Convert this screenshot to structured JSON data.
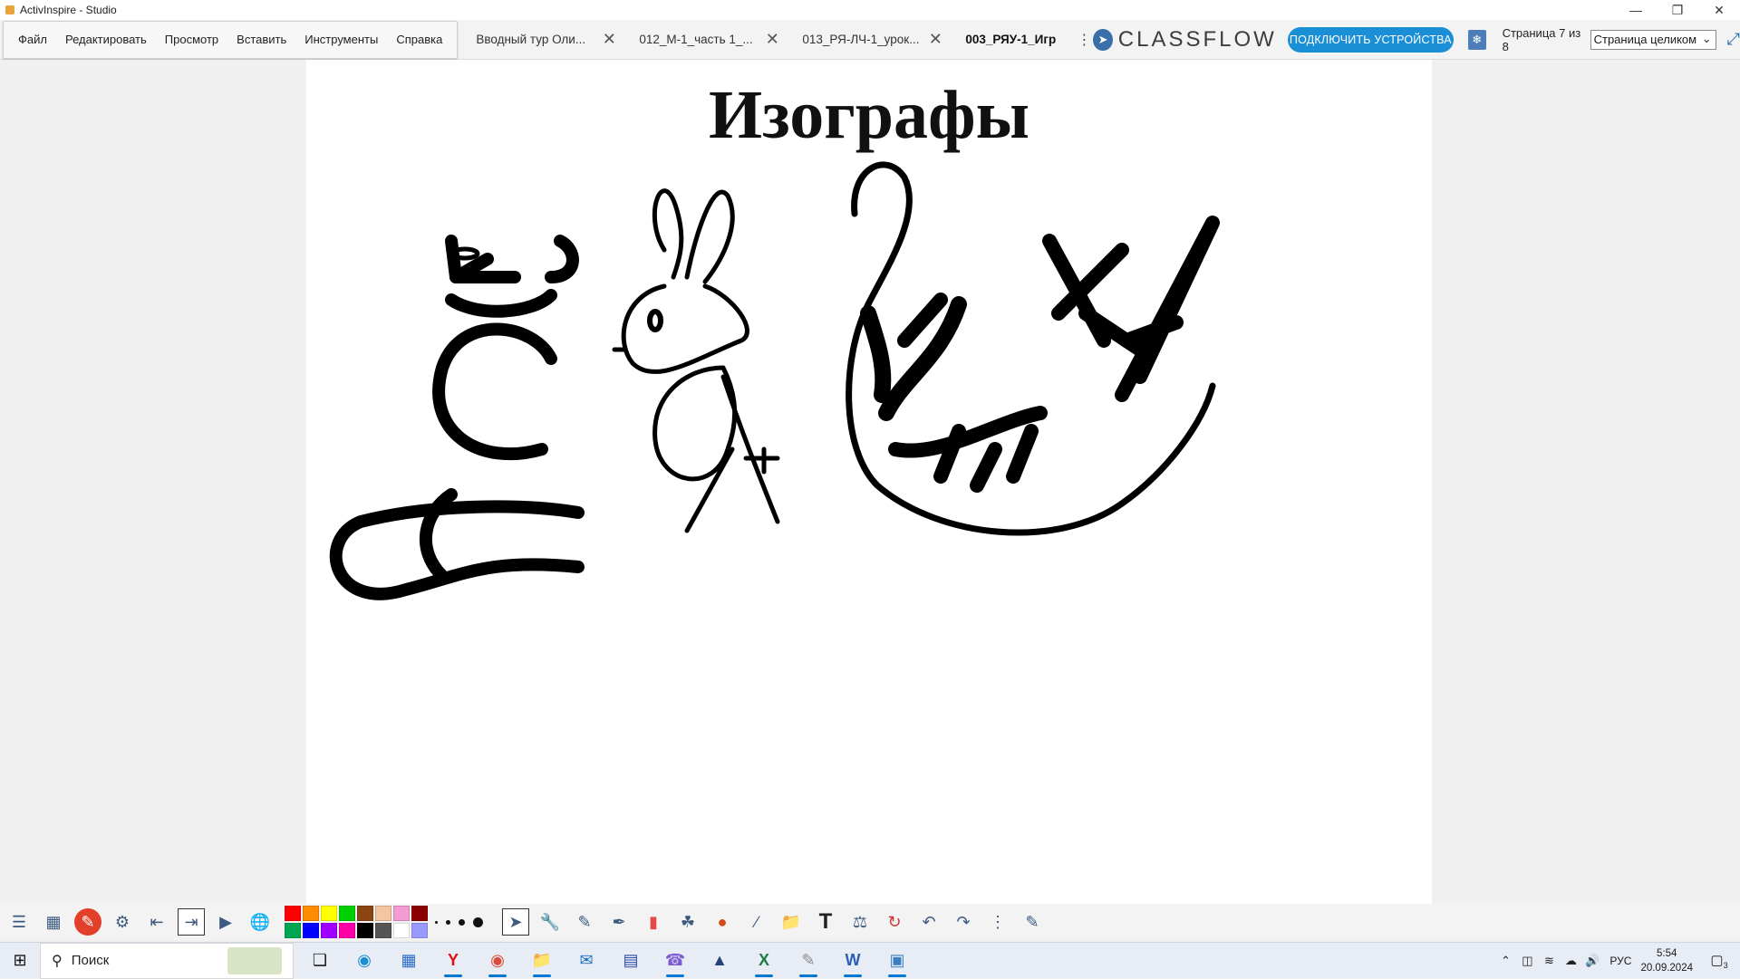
{
  "window": {
    "title": "ActivInspire - Studio",
    "controls": [
      "minimize",
      "restore",
      "close"
    ]
  },
  "menu": [
    "Файл",
    "Редактировать",
    "Просмотр",
    "Вставить",
    "Инструменты",
    "Справка"
  ],
  "tabs": [
    {
      "label": "Вводный тур Оли...",
      "active": false
    },
    {
      "label": "012_М-1_часть 1_...",
      "active": false
    },
    {
      "label": "013_РЯ-ЛЧ-1_урок...",
      "active": false
    },
    {
      "label": "003_РЯУ-1_Игр",
      "active": true
    }
  ],
  "classflow": {
    "logo_text": "CLASSFLOW",
    "connect_label": "ПОДКЛЮЧИТЬ УСТРОЙСТВА"
  },
  "page_nav": {
    "indicator": "Страница 7 из 8",
    "zoom_value": "Страница целиком"
  },
  "page": {
    "title": "Изографы"
  },
  "toolbox": {
    "colors_row1": [
      "#ff0000",
      "#ff8c00",
      "#ffff00",
      "#00d000",
      "#8b4513",
      "#f5c6a0",
      "#f49ad4",
      "#8b0000"
    ],
    "colors_row2": [
      "#00a651",
      "#0000ff",
      "#a000ff",
      "#ff00a8",
      "#000000",
      "#555555",
      "#ffffff",
      "#9999ff"
    ]
  },
  "taskbar": {
    "search_placeholder": "Поиск",
    "language": "РУС",
    "time": "5:54",
    "date": "20.09.2024",
    "notifications": "3"
  }
}
